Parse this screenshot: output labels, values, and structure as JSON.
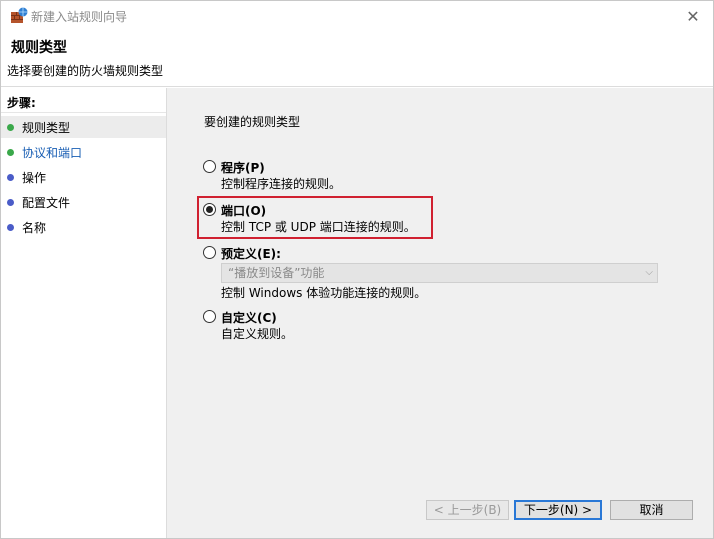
{
  "window": {
    "title": "新建入站规则向导",
    "close_label": "✕"
  },
  "header": {
    "title": "规则类型",
    "subtitle": "选择要创建的防火墙规则类型"
  },
  "steps": {
    "heading": "步骤:",
    "items": [
      {
        "label": "规则类型",
        "dot_color": "#3aa84a"
      },
      {
        "label": "协议和端口",
        "dot_color": "#3aa84a"
      },
      {
        "label": "操作",
        "dot_color": "#4a5cc8"
      },
      {
        "label": "配置文件",
        "dot_color": "#4a5cc8"
      },
      {
        "label": "名称",
        "dot_color": "#4a5cc8"
      }
    ]
  },
  "main": {
    "prompt": "要创建的规则类型",
    "options": [
      {
        "label": "程序(P)",
        "description": "控制程序连接的规则。",
        "checked": false
      },
      {
        "label": "端口(O)",
        "description": "控制 TCP 或 UDP 端口连接的规则。",
        "checked": true
      },
      {
        "label": "预定义(E):",
        "description": "控制 Windows 体验功能连接的规则。",
        "checked": false
      },
      {
        "label": "自定义(C)",
        "description": "自定义规则。",
        "checked": false
      }
    ],
    "predefined_select": {
      "value": "“播放到设备”功能",
      "arrow": "⌵"
    }
  },
  "buttons": {
    "back": "< 上一步(B)",
    "next": "下一步(N) >",
    "cancel": "取消"
  },
  "colors": {
    "highlight": "#d02030",
    "accent": "#2a78d6"
  }
}
